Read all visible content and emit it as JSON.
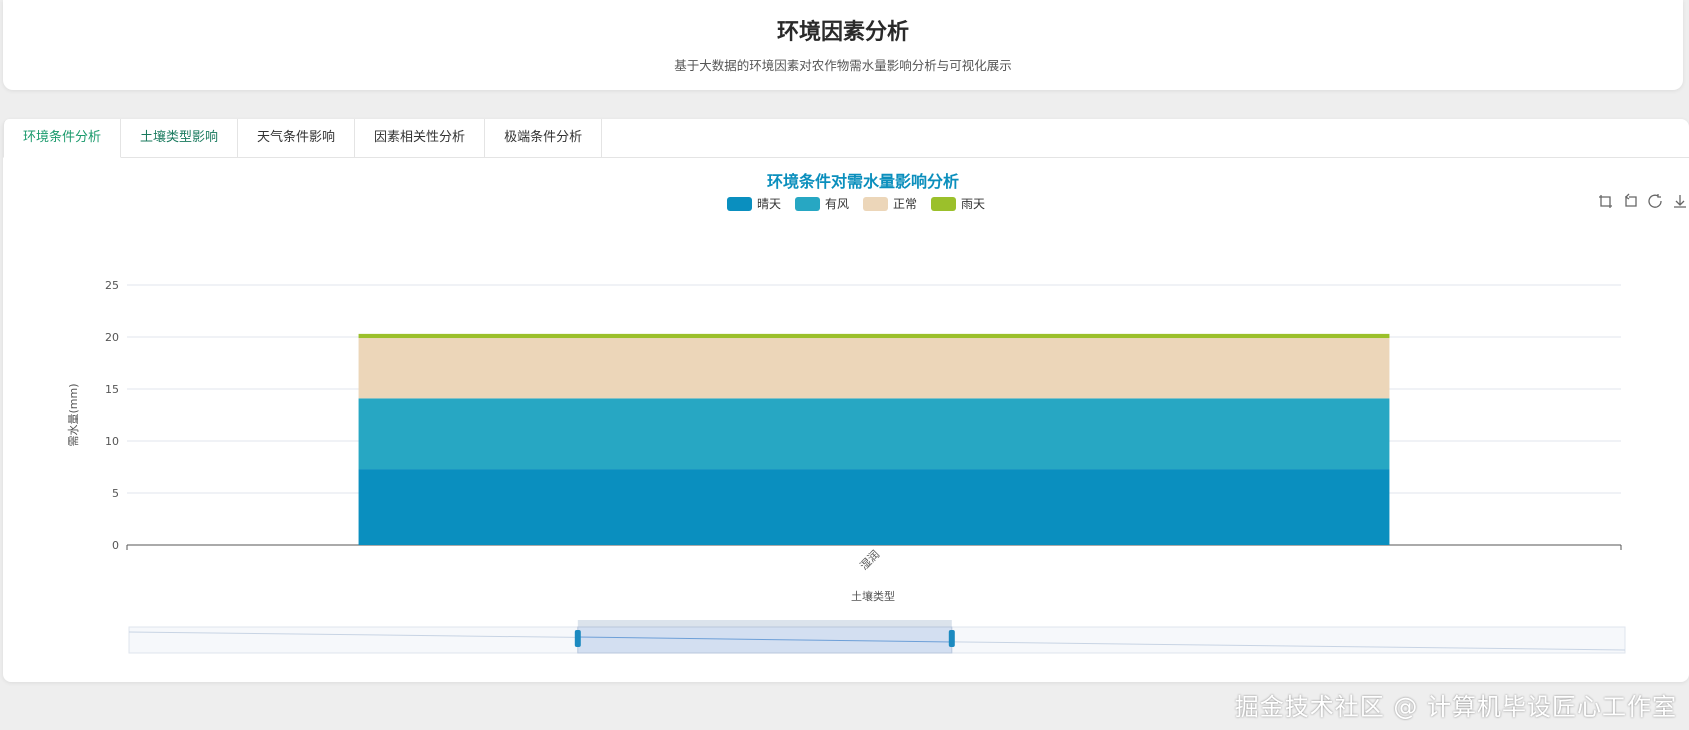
{
  "header": {
    "title": "环境因素分析",
    "subtitle": "基于大数据的环境因素对农作物需水量影响分析与可视化展示"
  },
  "tabs": [
    {
      "label": "环境条件分析"
    },
    {
      "label": "土壤类型影响"
    },
    {
      "label": "天气条件影响"
    },
    {
      "label": "因素相关性分析"
    },
    {
      "label": "极端条件分析"
    }
  ],
  "toolbox": {
    "icons": [
      "zoom-icon",
      "zoom-back-icon",
      "restore-icon",
      "save-icon"
    ]
  },
  "colors": {
    "title": "#0b8fbd",
    "series": [
      "#0a8fbf",
      "#27a7c3",
      "#ecd6b9",
      "#9bc02b"
    ]
  },
  "chart_data": {
    "type": "bar",
    "stacked": true,
    "title": "环境条件对需水量影响分析",
    "categories": [
      "湿润"
    ],
    "series": [
      {
        "name": "晴天",
        "values": [
          7.3
        ]
      },
      {
        "name": "有风",
        "values": [
          6.8
        ]
      },
      {
        "name": "正常",
        "values": [
          5.8
        ]
      },
      {
        "name": "雨天",
        "values": [
          0.4
        ]
      }
    ],
    "xlabel": "土壤类型",
    "ylabel": "需水量(mm)",
    "ylim": [
      0,
      25
    ],
    "yticks": [
      0,
      5,
      10,
      15,
      20,
      25
    ],
    "grid": true,
    "legend": "top-center",
    "datazoom_range_percent": [
      30,
      55
    ]
  },
  "watermark": "掘金技术社区 @ 计算机毕设匠心工作室"
}
